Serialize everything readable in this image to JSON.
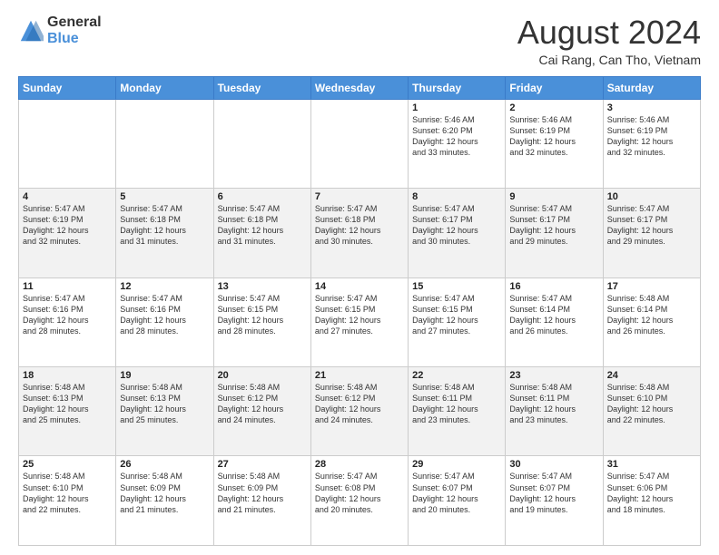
{
  "logo": {
    "general": "General",
    "blue": "Blue"
  },
  "title": {
    "month_year": "August 2024",
    "location": "Cai Rang, Can Tho, Vietnam"
  },
  "days_of_week": [
    "Sunday",
    "Monday",
    "Tuesday",
    "Wednesday",
    "Thursday",
    "Friday",
    "Saturday"
  ],
  "weeks": [
    [
      {
        "day": "",
        "info": ""
      },
      {
        "day": "",
        "info": ""
      },
      {
        "day": "",
        "info": ""
      },
      {
        "day": "",
        "info": ""
      },
      {
        "day": "1",
        "info": "Sunrise: 5:46 AM\nSunset: 6:20 PM\nDaylight: 12 hours\nand 33 minutes."
      },
      {
        "day": "2",
        "info": "Sunrise: 5:46 AM\nSunset: 6:19 PM\nDaylight: 12 hours\nand 32 minutes."
      },
      {
        "day": "3",
        "info": "Sunrise: 5:46 AM\nSunset: 6:19 PM\nDaylight: 12 hours\nand 32 minutes."
      }
    ],
    [
      {
        "day": "4",
        "info": "Sunrise: 5:47 AM\nSunset: 6:19 PM\nDaylight: 12 hours\nand 32 minutes."
      },
      {
        "day": "5",
        "info": "Sunrise: 5:47 AM\nSunset: 6:18 PM\nDaylight: 12 hours\nand 31 minutes."
      },
      {
        "day": "6",
        "info": "Sunrise: 5:47 AM\nSunset: 6:18 PM\nDaylight: 12 hours\nand 31 minutes."
      },
      {
        "day": "7",
        "info": "Sunrise: 5:47 AM\nSunset: 6:18 PM\nDaylight: 12 hours\nand 30 minutes."
      },
      {
        "day": "8",
        "info": "Sunrise: 5:47 AM\nSunset: 6:17 PM\nDaylight: 12 hours\nand 30 minutes."
      },
      {
        "day": "9",
        "info": "Sunrise: 5:47 AM\nSunset: 6:17 PM\nDaylight: 12 hours\nand 29 minutes."
      },
      {
        "day": "10",
        "info": "Sunrise: 5:47 AM\nSunset: 6:17 PM\nDaylight: 12 hours\nand 29 minutes."
      }
    ],
    [
      {
        "day": "11",
        "info": "Sunrise: 5:47 AM\nSunset: 6:16 PM\nDaylight: 12 hours\nand 28 minutes."
      },
      {
        "day": "12",
        "info": "Sunrise: 5:47 AM\nSunset: 6:16 PM\nDaylight: 12 hours\nand 28 minutes."
      },
      {
        "day": "13",
        "info": "Sunrise: 5:47 AM\nSunset: 6:15 PM\nDaylight: 12 hours\nand 28 minutes."
      },
      {
        "day": "14",
        "info": "Sunrise: 5:47 AM\nSunset: 6:15 PM\nDaylight: 12 hours\nand 27 minutes."
      },
      {
        "day": "15",
        "info": "Sunrise: 5:47 AM\nSunset: 6:15 PM\nDaylight: 12 hours\nand 27 minutes."
      },
      {
        "day": "16",
        "info": "Sunrise: 5:47 AM\nSunset: 6:14 PM\nDaylight: 12 hours\nand 26 minutes."
      },
      {
        "day": "17",
        "info": "Sunrise: 5:48 AM\nSunset: 6:14 PM\nDaylight: 12 hours\nand 26 minutes."
      }
    ],
    [
      {
        "day": "18",
        "info": "Sunrise: 5:48 AM\nSunset: 6:13 PM\nDaylight: 12 hours\nand 25 minutes."
      },
      {
        "day": "19",
        "info": "Sunrise: 5:48 AM\nSunset: 6:13 PM\nDaylight: 12 hours\nand 25 minutes."
      },
      {
        "day": "20",
        "info": "Sunrise: 5:48 AM\nSunset: 6:12 PM\nDaylight: 12 hours\nand 24 minutes."
      },
      {
        "day": "21",
        "info": "Sunrise: 5:48 AM\nSunset: 6:12 PM\nDaylight: 12 hours\nand 24 minutes."
      },
      {
        "day": "22",
        "info": "Sunrise: 5:48 AM\nSunset: 6:11 PM\nDaylight: 12 hours\nand 23 minutes."
      },
      {
        "day": "23",
        "info": "Sunrise: 5:48 AM\nSunset: 6:11 PM\nDaylight: 12 hours\nand 23 minutes."
      },
      {
        "day": "24",
        "info": "Sunrise: 5:48 AM\nSunset: 6:10 PM\nDaylight: 12 hours\nand 22 minutes."
      }
    ],
    [
      {
        "day": "25",
        "info": "Sunrise: 5:48 AM\nSunset: 6:10 PM\nDaylight: 12 hours\nand 22 minutes."
      },
      {
        "day": "26",
        "info": "Sunrise: 5:48 AM\nSunset: 6:09 PM\nDaylight: 12 hours\nand 21 minutes."
      },
      {
        "day": "27",
        "info": "Sunrise: 5:48 AM\nSunset: 6:09 PM\nDaylight: 12 hours\nand 21 minutes."
      },
      {
        "day": "28",
        "info": "Sunrise: 5:47 AM\nSunset: 6:08 PM\nDaylight: 12 hours\nand 20 minutes."
      },
      {
        "day": "29",
        "info": "Sunrise: 5:47 AM\nSunset: 6:07 PM\nDaylight: 12 hours\nand 20 minutes."
      },
      {
        "day": "30",
        "info": "Sunrise: 5:47 AM\nSunset: 6:07 PM\nDaylight: 12 hours\nand 19 minutes."
      },
      {
        "day": "31",
        "info": "Sunrise: 5:47 AM\nSunset: 6:06 PM\nDaylight: 12 hours\nand 18 minutes."
      }
    ]
  ]
}
